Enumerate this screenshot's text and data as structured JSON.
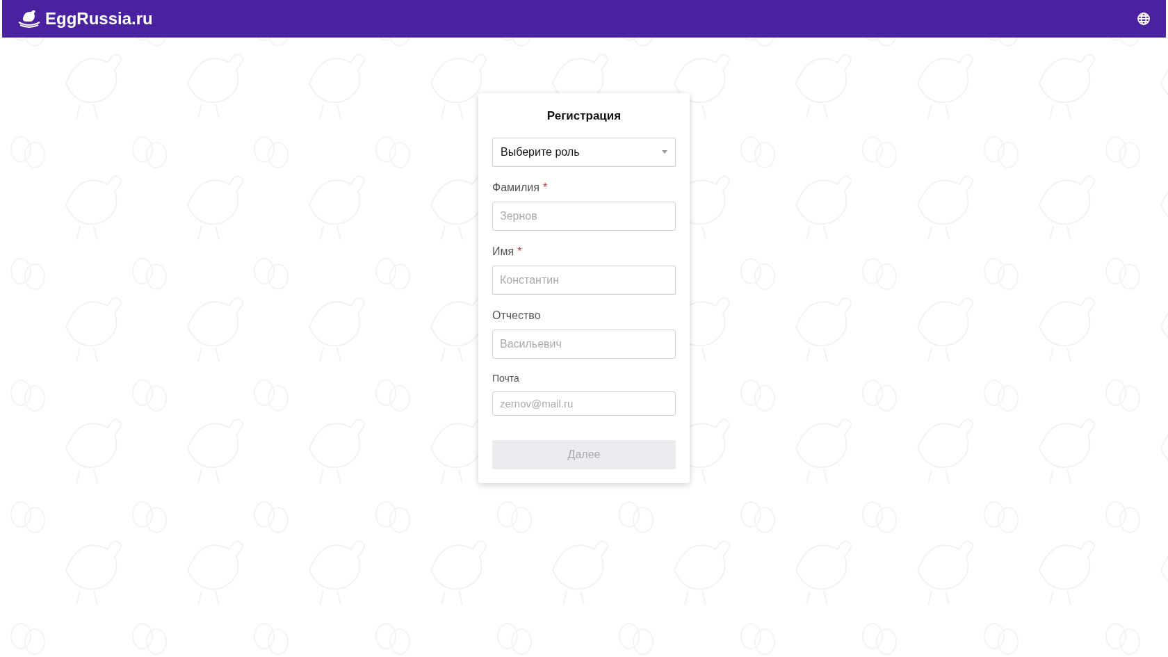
{
  "header": {
    "brand": "EggRussia.ru"
  },
  "form": {
    "title": "Регистрация",
    "fields": [
      {
        "kind": "select",
        "value": "Выберите роль"
      },
      {
        "kind": "text",
        "label": "Фамилия",
        "required_mark": "*",
        "placeholder": "Зернов"
      },
      {
        "kind": "text",
        "label": "Имя",
        "required_mark": "*",
        "placeholder": "Константин"
      },
      {
        "kind": "text",
        "label": "Отчество",
        "placeholder": "Васильевич"
      },
      {
        "kind": "small",
        "label": "Почта",
        "placeholder": "zernov@mail.ru"
      }
    ],
    "submit": {
      "label": "Далее",
      "disabled": true
    }
  }
}
